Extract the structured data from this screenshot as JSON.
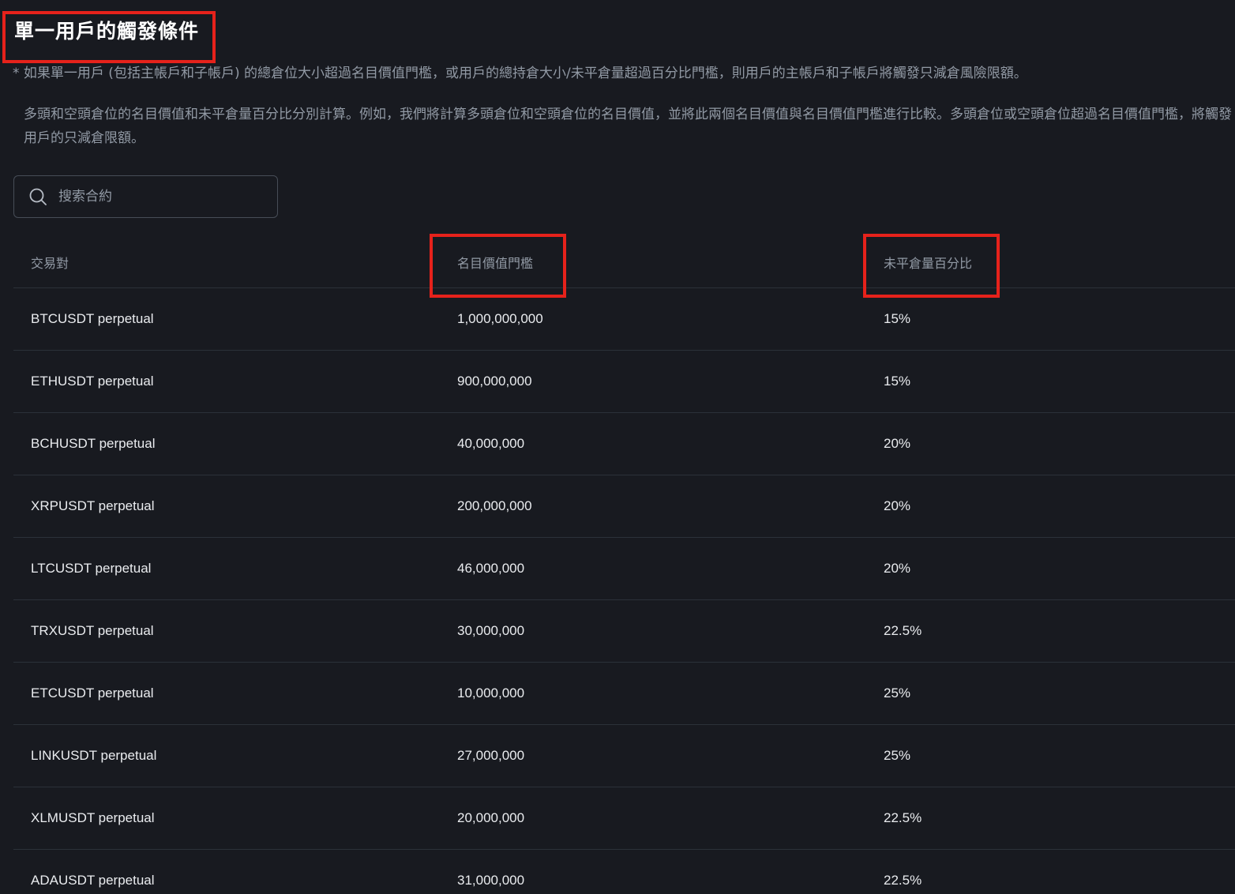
{
  "header": {
    "title": "單一用戶的觸發條件"
  },
  "note": "* 如果單一用戶 (包括主帳戶和子帳戶) 的總倉位大小超過名目價值門檻，或用戶的總持倉大小/未平倉量超過百分比門檻，則用戶的主帳戶和子帳戶將觸發只減倉風險限額。",
  "description": "多頭和空頭倉位的名目價值和未平倉量百分比分別計算。例如，我們將計算多頭倉位和空頭倉位的名目價值，並將此兩個名目價值與名目價值門檻進行比較。多頭倉位或空頭倉位超過名目價值門檻，將觸發用戶的只減倉限額。",
  "search": {
    "placeholder": "搜索合約",
    "icon": "search-icon"
  },
  "table": {
    "columns": [
      "交易對",
      "名目價值門檻",
      "未平倉量百分比"
    ],
    "rows": [
      {
        "pair": "BTCUSDT perpetual",
        "notional": "1,000,000,000",
        "oi_pct": "15%"
      },
      {
        "pair": "ETHUSDT perpetual",
        "notional": "900,000,000",
        "oi_pct": "15%"
      },
      {
        "pair": "BCHUSDT perpetual",
        "notional": "40,000,000",
        "oi_pct": "20%"
      },
      {
        "pair": "XRPUSDT perpetual",
        "notional": "200,000,000",
        "oi_pct": "20%"
      },
      {
        "pair": "LTCUSDT perpetual",
        "notional": "46,000,000",
        "oi_pct": "20%"
      },
      {
        "pair": "TRXUSDT perpetual",
        "notional": "30,000,000",
        "oi_pct": "22.5%"
      },
      {
        "pair": "ETCUSDT perpetual",
        "notional": "10,000,000",
        "oi_pct": "25%"
      },
      {
        "pair": "LINKUSDT perpetual",
        "notional": "27,000,000",
        "oi_pct": "25%"
      },
      {
        "pair": "XLMUSDT perpetual",
        "notional": "20,000,000",
        "oi_pct": "22.5%"
      },
      {
        "pair": "ADAUSDT perpetual",
        "notional": "31,000,000",
        "oi_pct": "22.5%"
      }
    ]
  },
  "colors": {
    "background": "#181a20",
    "text_primary": "#eaecef",
    "text_secondary": "#929aa5",
    "highlight": "#e6221b",
    "divider": "#2b3139"
  }
}
